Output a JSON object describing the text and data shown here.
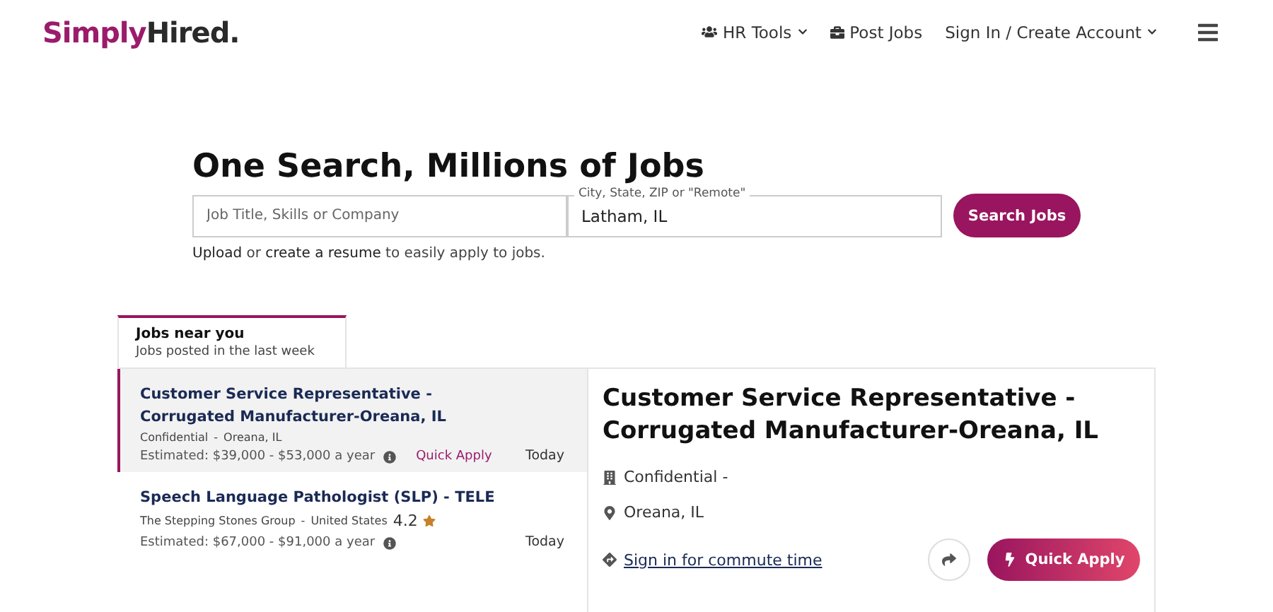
{
  "header": {
    "logo": {
      "part_1": "Simply",
      "part_2": "Hired."
    },
    "nav": [
      {
        "label": "HR Tools",
        "caret": true
      },
      {
        "label": "Post Jobs",
        "caret": false
      },
      {
        "label": "Sign In / Create Account",
        "caret": true
      }
    ]
  },
  "search": {
    "heading": "One Search, Millions of Jobs",
    "what_field": {
      "placeholder": "Job Title, Skills or Company"
    },
    "where_field": {
      "label": "City, State, ZIP or \"Remote\"",
      "value": "Latham, IL"
    },
    "button": "Search Jobs",
    "note": [
      {
        "kind": "link",
        "text": "Upload"
      },
      {
        "kind": "text",
        "text": " or "
      },
      {
        "kind": "link",
        "text": "create a resume"
      },
      {
        "kind": "text",
        "text": " to easily apply to jobs."
      }
    ]
  },
  "tab": {
    "title": "Jobs near you",
    "subtitle": "Jobs posted in the last week"
  },
  "jobs": [
    {
      "title": "Customer Service Representative - Corrugated Manufacturer-Oreana, IL",
      "company": "Confidential",
      "separator": "-",
      "location": "Oreana, IL",
      "salary": "Estimated: $39,000 - $53,000 a year",
      "quick_apply": "Quick Apply",
      "date": "Today",
      "selected": true
    },
    {
      "title": "Speech Language Pathologist (SLP) - TELE",
      "company": "The Stepping Stones Group",
      "separator": "-",
      "location": "United States",
      "rating": "4.2",
      "salary": "Estimated: $67,000 - $91,000 a year",
      "date": "Today",
      "selected": false
    }
  ],
  "detail": {
    "title": "Customer Service Representative - Corrugated Manufacturer-Oreana, IL",
    "company": "Confidential -",
    "location": "Oreana, IL",
    "commute_link": "Sign in for commute time",
    "apply_button": "Quick Apply"
  }
}
